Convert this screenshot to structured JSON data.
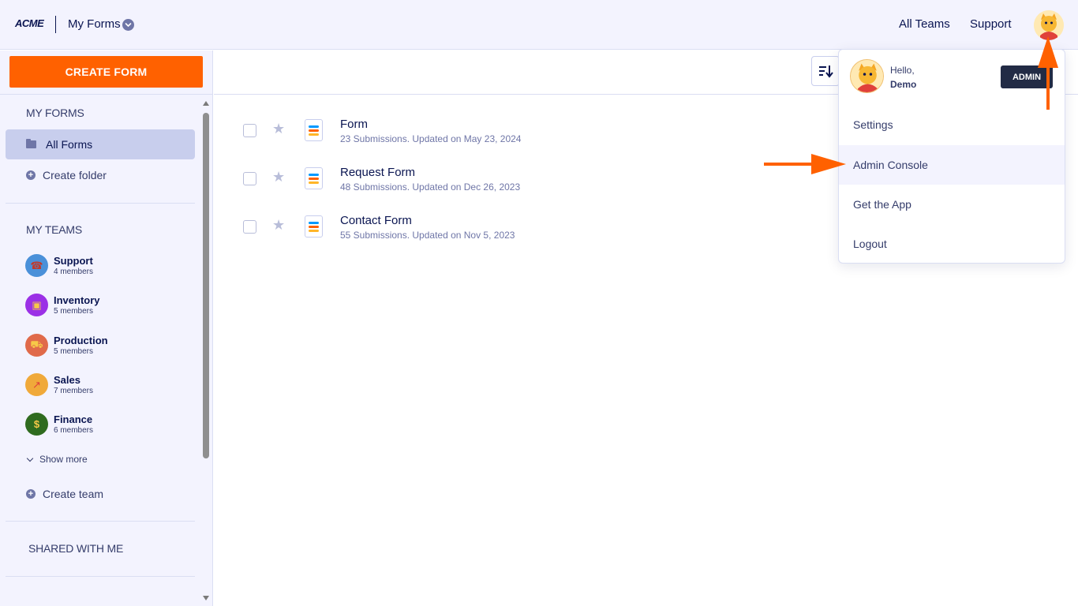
{
  "header": {
    "logo": "ACME",
    "title": "My Forms",
    "nav": [
      "All Teams",
      "Support"
    ],
    "user_avatar": "cat-avatar-icon"
  },
  "sidebar": {
    "create_button": "CREATE FORM",
    "my_forms_title": "MY FORMS",
    "all_forms": "All Forms",
    "create_folder": "Create folder",
    "my_teams_title": "MY TEAMS",
    "teams": [
      {
        "name": "Support",
        "members": "4 members",
        "icon": "☎",
        "color": "#4a90d9"
      },
      {
        "name": "Inventory",
        "members": "5 members",
        "icon": "▣",
        "color": "#9b30e6"
      },
      {
        "name": "Production",
        "members": "5 members",
        "icon": "⛟",
        "color": "#e06a4a"
      },
      {
        "name": "Sales",
        "members": "7 members",
        "icon": "↗",
        "color": "#f0a93a"
      },
      {
        "name": "Finance",
        "members": "6 members",
        "icon": "$",
        "color": "#2f6b1f"
      }
    ],
    "show_more": "Show more",
    "create_team": "Create team",
    "shared_title": "SHARED WITH ME"
  },
  "forms": [
    {
      "title": "Form",
      "meta": "23 Submissions. Updated on May 23, 2024"
    },
    {
      "title": "Request Form",
      "meta": "48 Submissions. Updated on Dec 26, 2023"
    },
    {
      "title": "Contact Form",
      "meta": "55 Submissions. Updated on Nov 5, 2023"
    }
  ],
  "dropdown": {
    "hello": "Hello,",
    "name": "Demo",
    "badge": "ADMIN",
    "items": [
      "Settings",
      "Admin Console",
      "Get the App",
      "Logout"
    ],
    "active_item": "Admin Console"
  },
  "colors": {
    "accent": "#ff6100",
    "navy": "#0a1551",
    "sidebar_bg": "#f3f3fe",
    "selected": "#c8ceed"
  }
}
